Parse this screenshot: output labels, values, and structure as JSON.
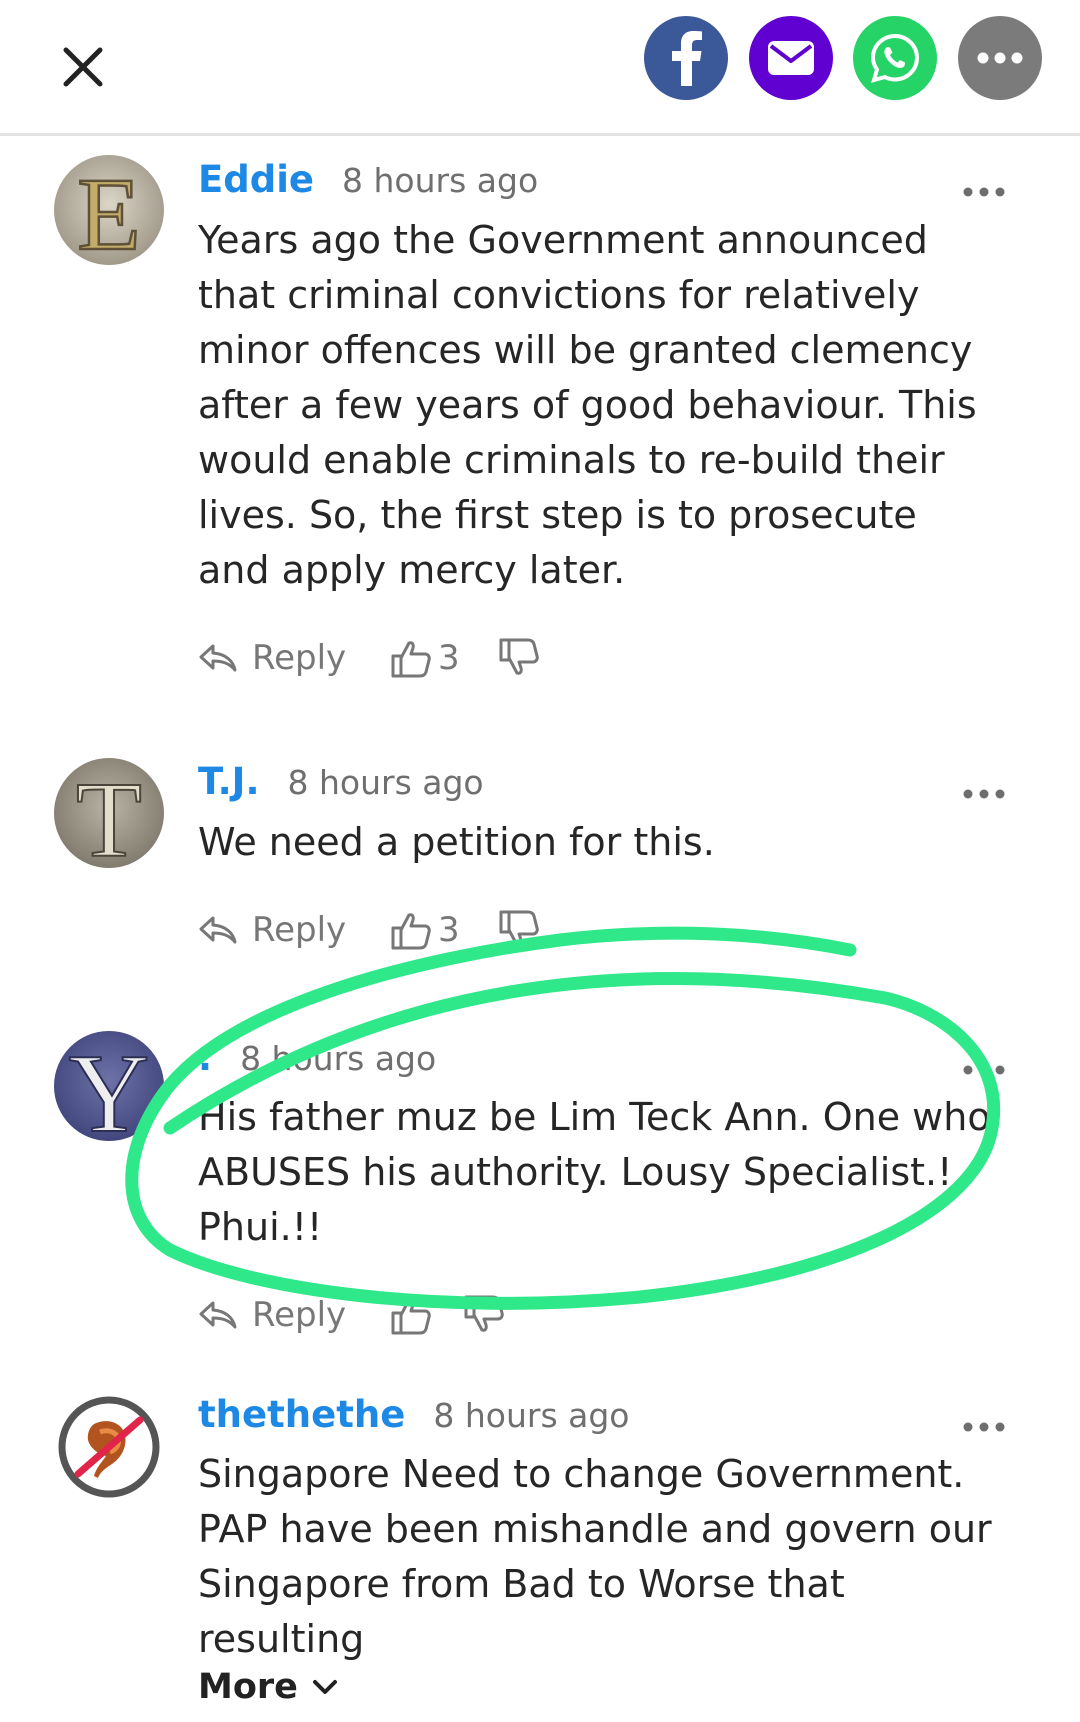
{
  "share_bar": {
    "close_icon": "close-icon",
    "buttons": [
      {
        "icon": "facebook-icon",
        "color": "#3b5998"
      },
      {
        "icon": "mail-icon",
        "color": "#6001d2"
      },
      {
        "icon": "whatsapp-icon",
        "color": "#25d366"
      },
      {
        "icon": "more-options-icon",
        "color": "#7b7b7b"
      }
    ]
  },
  "comments": [
    {
      "author": "Eddie",
      "time": "8 hours ago",
      "avatar_letter": "E",
      "text": "Years ago the Government announced that criminal convictions for relatively minor offences will be granted clemency after a few years of good behaviour. This would enable criminals to re-build their lives. So, the first step is to prosecute and apply mercy later.",
      "reply_label": "Reply",
      "likes": "3"
    },
    {
      "author": "T.J.",
      "time": "8 hours ago",
      "avatar_letter": "T",
      "text": "We need a petition for this.",
      "reply_label": "Reply",
      "likes": "3"
    },
    {
      "author": ".",
      "time": "8 hours ago",
      "avatar_letter": "Y",
      "text": "His father muz be Lim Teck Ann. One who ABUSES his authority. Lousy Specialist.! Phui.!!",
      "reply_label": "Reply",
      "likes": ""
    },
    {
      "author": "thethethe",
      "time": "8 hours ago",
      "text": "Singapore Need to change Government. PAP have been mishandle and govern our Singapore from Bad to Worse that resulting",
      "more_label": "More"
    }
  ],
  "colors": {
    "author": "#1e88e5",
    "annotation": "#2ee88a"
  }
}
